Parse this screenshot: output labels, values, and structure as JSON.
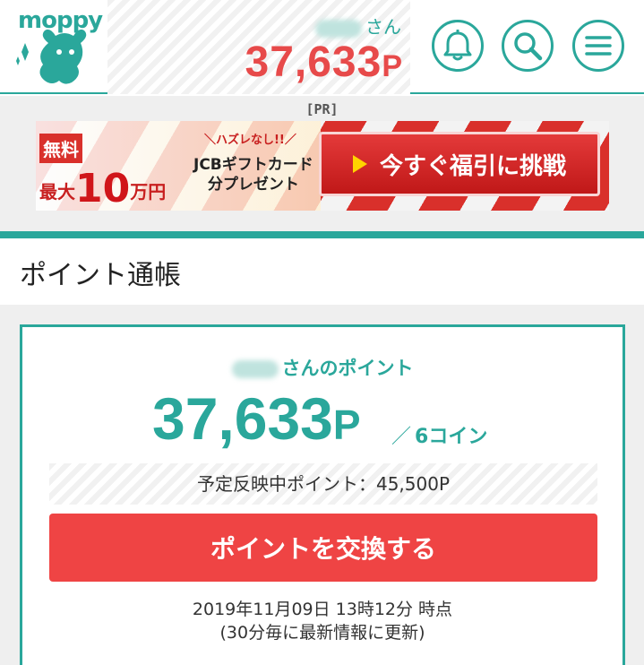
{
  "header": {
    "logo_text": "moppy",
    "user_suffix": "さん",
    "points_value": "37,633",
    "points_unit": "P",
    "icons": [
      "bell-icon",
      "search-icon",
      "menu-icon"
    ]
  },
  "pr": {
    "label": "[PR]",
    "banner": {
      "free_label": "無料",
      "max_prefix": "最大",
      "max_amount": "10",
      "max_suffix": "万円",
      "no_lose_text": "＼ハズレなし!!／",
      "gift_line1": "JCBギフトカード",
      "gift_line2": "分プレゼント",
      "button_label": "今すぐ福引に挑戦"
    }
  },
  "section": {
    "title": "ポイント通帳"
  },
  "card": {
    "user_suffix": "さんのポイント",
    "points_value": "37,633",
    "points_unit": "P",
    "coin_slash": "／",
    "coin_text": "6コイン",
    "pending_text": "予定反映中ポイント：45,500P",
    "exchange_label": "ポイントを交換する",
    "timestamp_line1": "2019年11月09日 13時12分 時点",
    "timestamp_line2": "(30分毎に最新情報に更新)"
  },
  "colors": {
    "brand_teal": "#2aa79b",
    "points_red": "#e74a4a",
    "button_red": "#ef4444"
  }
}
